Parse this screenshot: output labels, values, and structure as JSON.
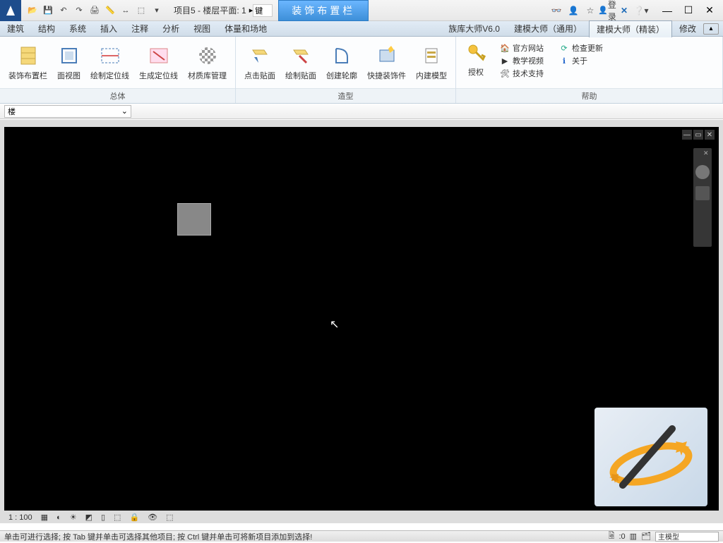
{
  "app": {
    "doc_title": "项目5 - 楼层平面: 1",
    "search_prefix": "键",
    "tooltip": "装饰布置栏",
    "login": "登录"
  },
  "menus": {
    "items": [
      "建筑",
      "结构",
      "系统",
      "插入",
      "注释",
      "分析",
      "视图",
      "体量和场地",
      "",
      "",
      "",
      "族库大师V6.0",
      "建模大师（通用）",
      "建模大师（精装）",
      "修改"
    ],
    "active_index": 13
  },
  "ribbon": {
    "groups": [
      {
        "label": "总体",
        "buttons": [
          {
            "label": "装饰布置栏",
            "icon": "panel"
          },
          {
            "label": "面视图",
            "icon": "face"
          },
          {
            "label": "绘制定位线",
            "icon": "drawline"
          },
          {
            "label": "生成定位线",
            "icon": "genline"
          },
          {
            "label": "材质库管理",
            "icon": "material"
          }
        ]
      },
      {
        "label": "造型",
        "buttons": [
          {
            "label": "点击贴面",
            "icon": "clickface"
          },
          {
            "label": "绘制贴面",
            "icon": "drawface"
          },
          {
            "label": "创建轮廓",
            "icon": "profile"
          },
          {
            "label": "快捷装饰件",
            "icon": "quick"
          },
          {
            "label": "内建模型",
            "icon": "model"
          }
        ]
      },
      {
        "label": "帮助",
        "auth_button": {
          "label": "授权",
          "icon": "key"
        },
        "links": [
          {
            "label": "官方网站",
            "icon": "home"
          },
          {
            "label": "教学视频",
            "icon": "video"
          },
          {
            "label": "技术支持",
            "icon": "support"
          }
        ],
        "links2": [
          {
            "label": "检查更新",
            "icon": "refresh"
          },
          {
            "label": "关于",
            "icon": "info"
          }
        ]
      }
    ]
  },
  "type_selector": {
    "value": "楼"
  },
  "view_toolbar": {
    "scale": "1 : 100"
  },
  "status": {
    "hint": "单击可进行选择; 按 Tab 键并单击可选择其他项目; 按 Ctrl 键并单击可将新项目添加到选择!",
    "count": ":0",
    "model_label": "主模型"
  }
}
